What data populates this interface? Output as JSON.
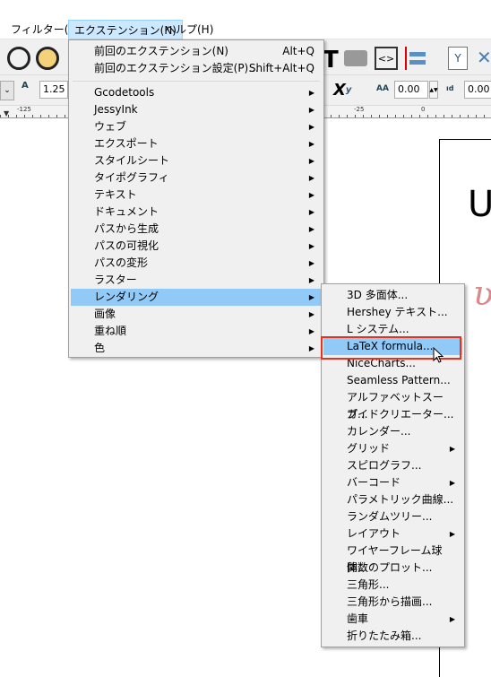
{
  "menubar": {
    "items": [
      {
        "label": "フィルター(S)"
      },
      {
        "label": "エクステンション(N)"
      },
      {
        "label": "ヘルプ(H)"
      }
    ]
  },
  "toolbar2": {
    "line_spacing": "1.25",
    "letter_spacing": "0.00",
    "word_spacing": "0.00"
  },
  "ruler": {
    "ticks": [
      "-125",
      "-25",
      "0"
    ]
  },
  "canvas": {
    "text": "U"
  },
  "extensions_menu": {
    "top": [
      {
        "label": "前回のエクステンション(N)",
        "shortcut": "Alt+Q"
      },
      {
        "label": "前回のエクステンション設定(P)...",
        "shortcut": "Shift+Alt+Q"
      }
    ],
    "items": [
      {
        "label": "Gcodetools",
        "sub": true
      },
      {
        "label": "JessyInk",
        "sub": true
      },
      {
        "label": "ウェブ",
        "sub": true
      },
      {
        "label": "エクスポート",
        "sub": true
      },
      {
        "label": "スタイルシート",
        "sub": true
      },
      {
        "label": "タイポグラフィ",
        "sub": true
      },
      {
        "label": "テキスト",
        "sub": true
      },
      {
        "label": "ドキュメント",
        "sub": true
      },
      {
        "label": "パスから生成",
        "sub": true
      },
      {
        "label": "パスの可視化",
        "sub": true
      },
      {
        "label": "パスの変形",
        "sub": true
      },
      {
        "label": "ラスター",
        "sub": true
      },
      {
        "label": "レンダリング",
        "sub": true,
        "highlighted": true
      },
      {
        "label": "画像",
        "sub": true
      },
      {
        "label": "重ね順",
        "sub": true
      },
      {
        "label": "色",
        "sub": true
      }
    ]
  },
  "render_submenu": {
    "items": [
      {
        "label": "3D 多面体..."
      },
      {
        "label": "Hershey テキスト..."
      },
      {
        "label": "L システム..."
      },
      {
        "label": "LaTeX formula...",
        "highlighted": true
      },
      {
        "label": "NiceCharts..."
      },
      {
        "label": "Seamless Pattern..."
      },
      {
        "label": "アルファベットスープ..."
      },
      {
        "label": "ガイドクリエーター..."
      },
      {
        "label": "カレンダー..."
      },
      {
        "label": "グリッド",
        "sub": true
      },
      {
        "label": "スピログラフ..."
      },
      {
        "label": "バーコード",
        "sub": true
      },
      {
        "label": "パラメトリック曲線..."
      },
      {
        "label": "ランダムツリー..."
      },
      {
        "label": "レイアウト",
        "sub": true
      },
      {
        "label": "ワイヤーフレーム球体..."
      },
      {
        "label": "関数のプロット..."
      },
      {
        "label": "三角形..."
      },
      {
        "label": "三角形から描画..."
      },
      {
        "label": "歯車",
        "sub": true
      },
      {
        "label": "折りたたみ箱..."
      }
    ]
  },
  "colors": {
    "highlight": "#91c9f7",
    "annotation_box": "#e8321e",
    "menu_bg": "#f0f0f0"
  }
}
